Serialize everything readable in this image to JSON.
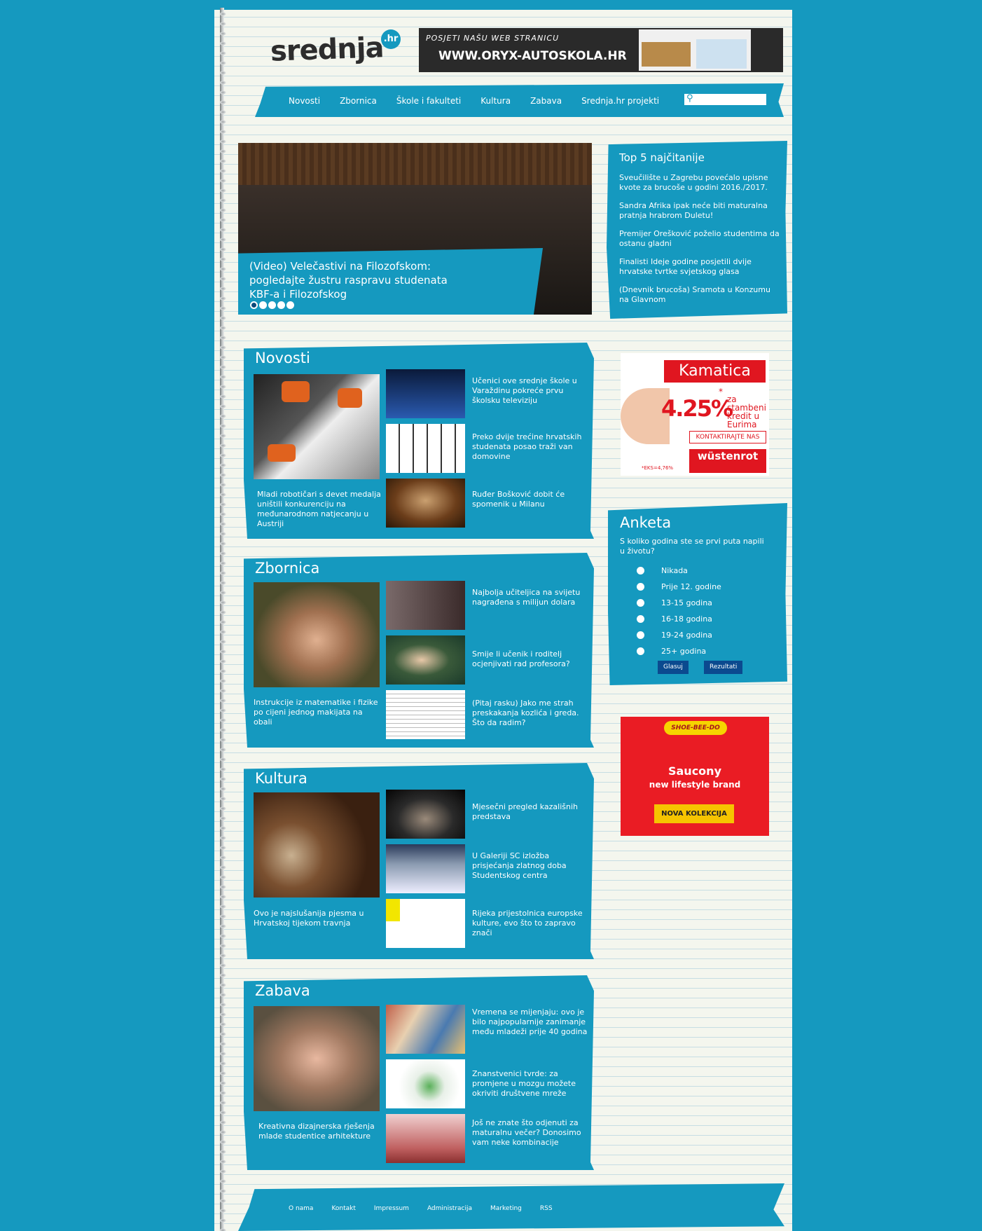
{
  "site": {
    "logo": "srednja",
    "logo_suffix": ".hr",
    "accent": "#1599bf"
  },
  "top_banner": {
    "line1": "POSJETI NAŠU WEB STRANICU",
    "line2": "WWW.ORYX-AUTOSKOLA.HR"
  },
  "nav": {
    "items": [
      "Novosti",
      "Zbornica",
      "Škole i fakulteti",
      "Kultura",
      "Zabava",
      "Srednja.hr projekti"
    ],
    "search_icon": "search-icon",
    "search_placeholder": ""
  },
  "slider": {
    "title": "(Video) Velečastivi na Filozofskom: pogledajte žustru raspravu studenata KBF-a i Filozofskog",
    "dots": 5,
    "active_dot": 1
  },
  "top5": {
    "title": "Top 5 najčitanije",
    "items": [
      "Sveučilište u Zagrebu povećalo upisne kvote za brucoše u godini 2016./2017.",
      "Sandra Afrika ipak neće biti maturalna pratnja hrabrom Duletu!",
      "Premijer Orešković poželio studentima da ostanu gladni",
      "Finalisti Ideje godine posjetili dvije hrvatske tvrtke svjetskog glasa",
      "(Dnevnik brucoša) Sramota u Konzumu na Glavnom"
    ]
  },
  "sections": [
    {
      "title": "Novosti",
      "main": "Mladi robotičari s devet medalja uništili konkurenciju na međunarodnom natjecanju u Austriji",
      "items": [
        "Učenici ove srednje škole u Varaždinu pokreće prvu školsku televiziju",
        "Preko dvije trećine hrvatskih studenata posao traži van domovine",
        "Ruđer Bošković dobit će spomenik u Milanu"
      ]
    },
    {
      "title": "Zbornica",
      "main": "Instrukcije iz matematike i fizike po cijeni jednog makijata na obali",
      "items": [
        "Najbolja učiteljica na svijetu nagrađena s milijun dolara",
        "Smije li učenik i roditelj ocjenjivati rad profesora?",
        "(Pitaj rasku) Jako me strah preskakanja kozlića i greda. Što da radim?"
      ]
    },
    {
      "title": "Kultura",
      "main": "Ovo je najslušanija pjesma u Hrvatskoj tijekom travnja",
      "items": [
        "Mjesečni pregled kazališnih predstava",
        "U Galeriji SC izložba prisjećanja zlatnog doba Studentskog centra",
        "Rijeka prijestolnica europske kulture, evo što to zapravo znači"
      ]
    },
    {
      "title": "Zabava",
      "main": "Kreativna dizajnerska rješenja mlade studentice arhitekture",
      "items": [
        "Vremena se mijenjaju: ovo je bilo najpopularnije zanimanje među mladeži prije 40 godina",
        "Znanstvenici tvrde: za promjene u mozgu možete okriviti društvene mreže",
        "Još ne znate što odjenuti za maturalnu večer? Donosimo vam neke kombinacije"
      ]
    }
  ],
  "ad_kamatica": {
    "brand": "Kamatica",
    "rate": "4.25%",
    "star": "*",
    "sub": "za stambeni kredit u Eurima",
    "cta": "KONTAKTIRAJTE NAS",
    "company": "wüstenrot",
    "eks": "*EKS=4,76%"
  },
  "poll": {
    "title": "Anketa",
    "question": "S koliko godina ste se prvi puta napili u životu?",
    "options": [
      "Nikada",
      "Prije 12. godine",
      "13-15 godina",
      "16-18 godina",
      "19-24 godina",
      "25+ godina"
    ],
    "vote": "Glasuj",
    "results": "Rezultati"
  },
  "ad_saucony": {
    "logo": "SHOE-BEE-DO",
    "brand": "Saucony",
    "tagline": "new lifestyle brand",
    "cta": "NOVA KOLEKCIJA"
  },
  "footer": {
    "links": [
      "O nama",
      "Kontakt",
      "Impressum",
      "Administracija",
      "Marketing",
      "RSS"
    ]
  }
}
